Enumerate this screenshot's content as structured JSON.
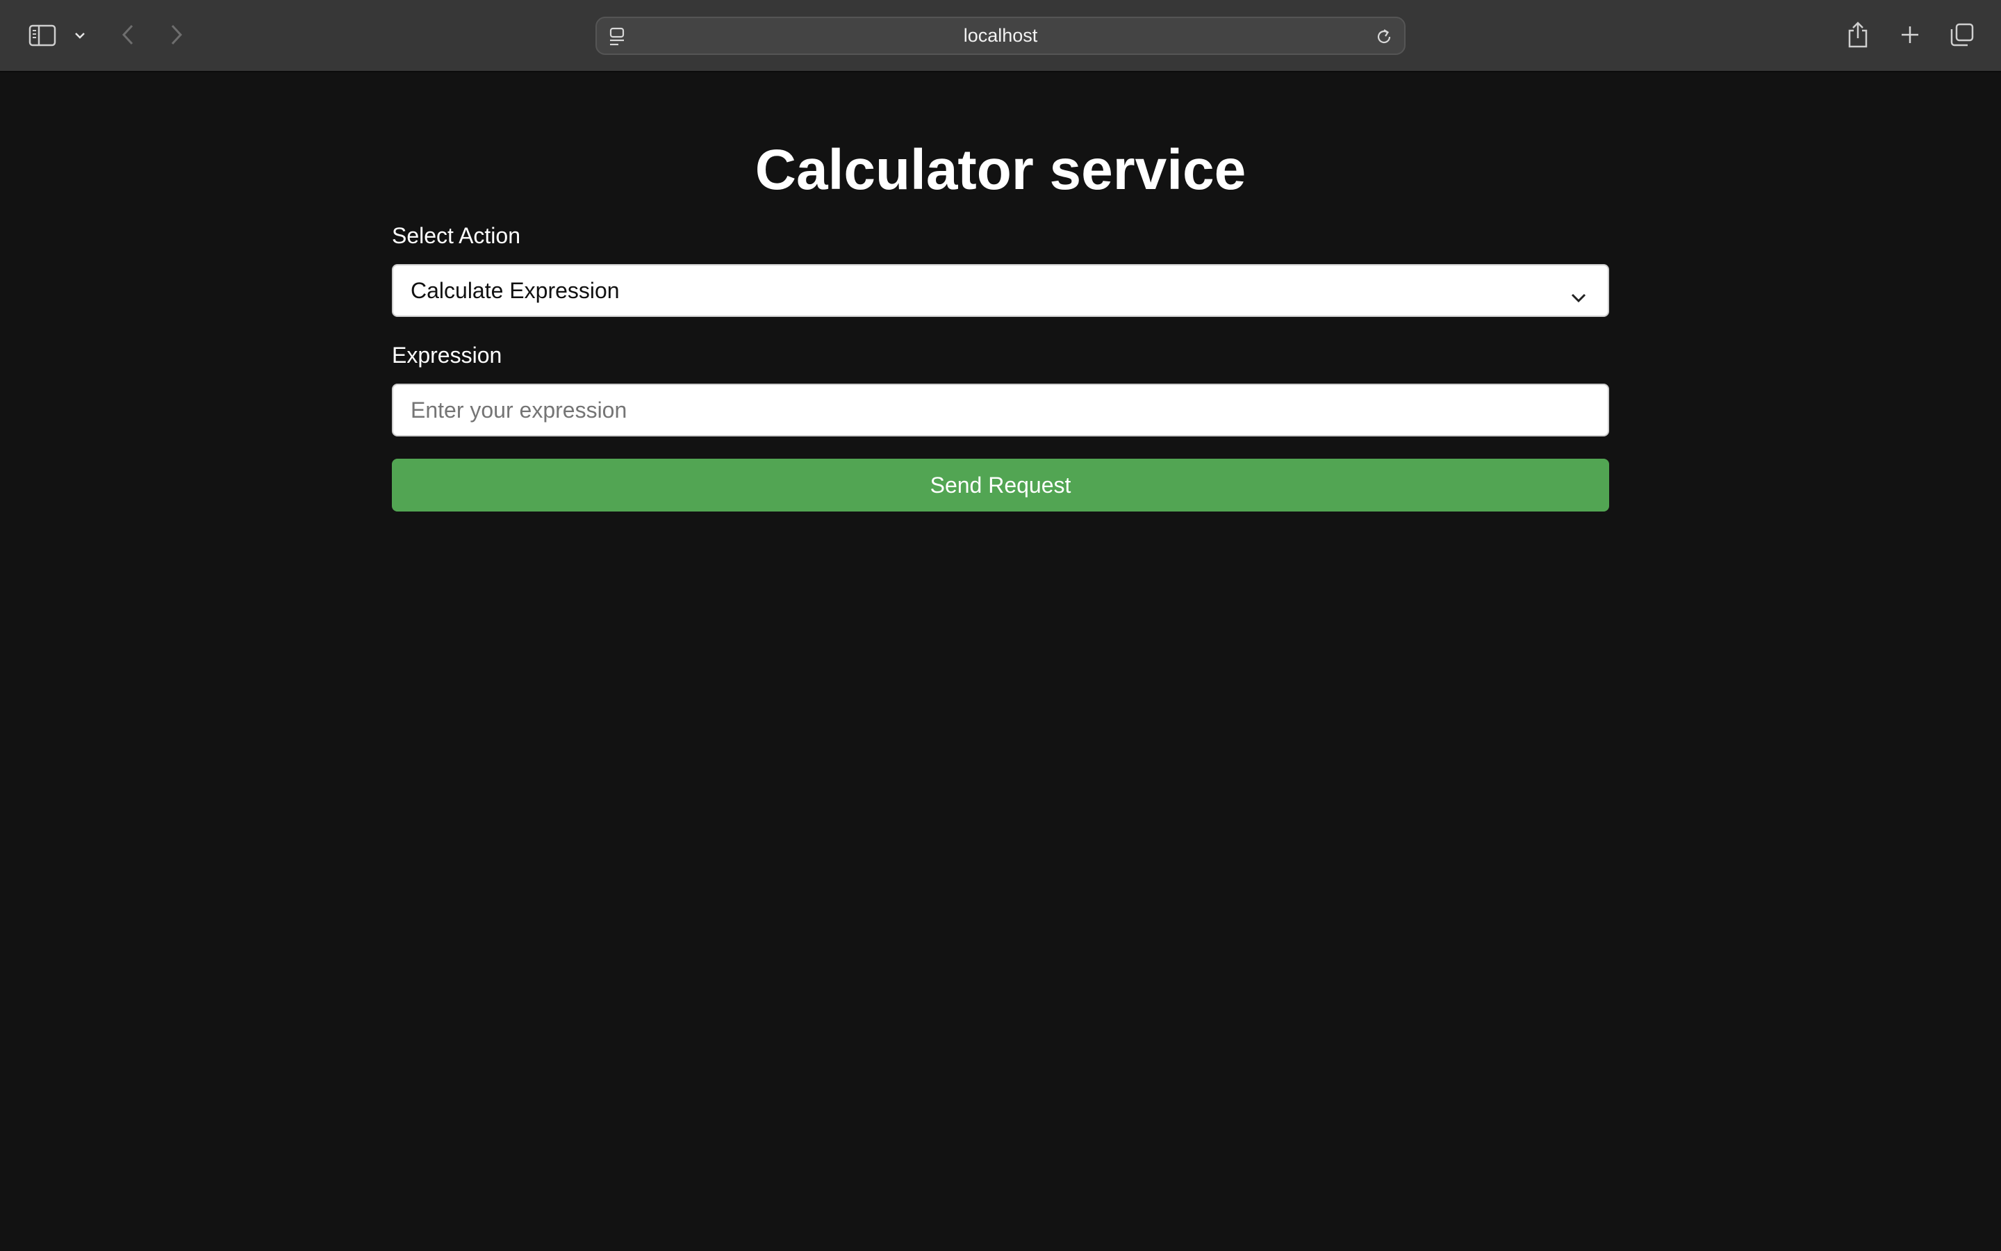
{
  "browser": {
    "address": "localhost",
    "icons": [
      "sidebar-icon",
      "chevron-down-icon",
      "back-icon",
      "forward-icon",
      "page-menu-icon",
      "reload-icon",
      "share-icon",
      "plus-icon",
      "tabs-icon"
    ]
  },
  "page": {
    "title": "Calculator service",
    "action_label": "Select Action",
    "action_value": "Calculate Expression",
    "expression_label": "Expression",
    "expression_placeholder": "Enter your expression",
    "send_label": "Send Request"
  },
  "colors": {
    "background": "#121212",
    "toolbar": "#373737",
    "button": "#52a553"
  }
}
